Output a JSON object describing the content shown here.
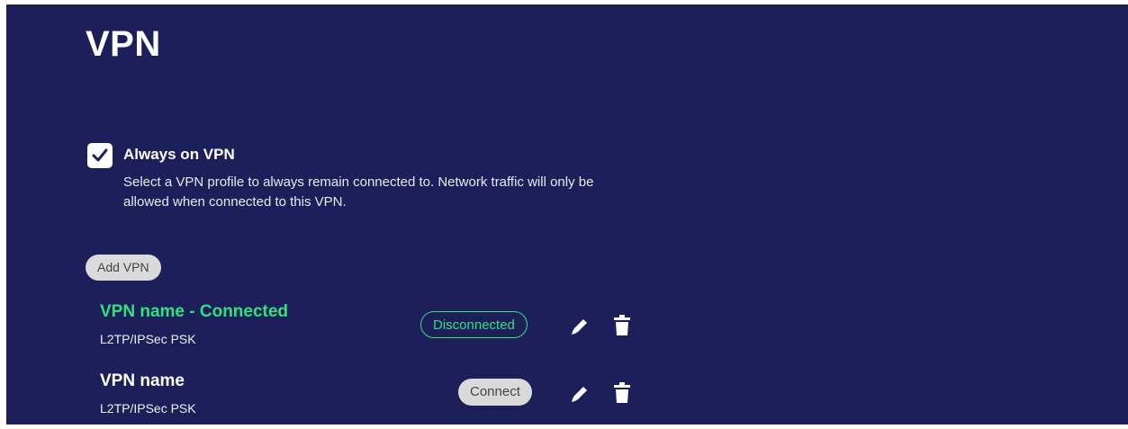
{
  "page": {
    "title": "VPN"
  },
  "always_on": {
    "label": "Always on VPN",
    "checked": true,
    "description": "Select a VPN profile to always remain connected to. Network traffic will only be allowed when connected to this VPN."
  },
  "add_button": {
    "label": "Add VPN"
  },
  "vpns": [
    {
      "name": "VPN name - Connected",
      "type": "L2TP/IPSec PSK",
      "button_label": "Disconnected",
      "edit_icon": "pencil-icon",
      "delete_icon": "trash-icon"
    },
    {
      "name": "VPN name",
      "type": "L2TP/IPSec PSK",
      "button_label": "Connect",
      "edit_icon": "pencil-icon",
      "delete_icon": "trash-icon"
    }
  ],
  "colors": {
    "background": "#1c1f5a",
    "accent_green": "#32e07d",
    "button_gray": "#dadada"
  }
}
